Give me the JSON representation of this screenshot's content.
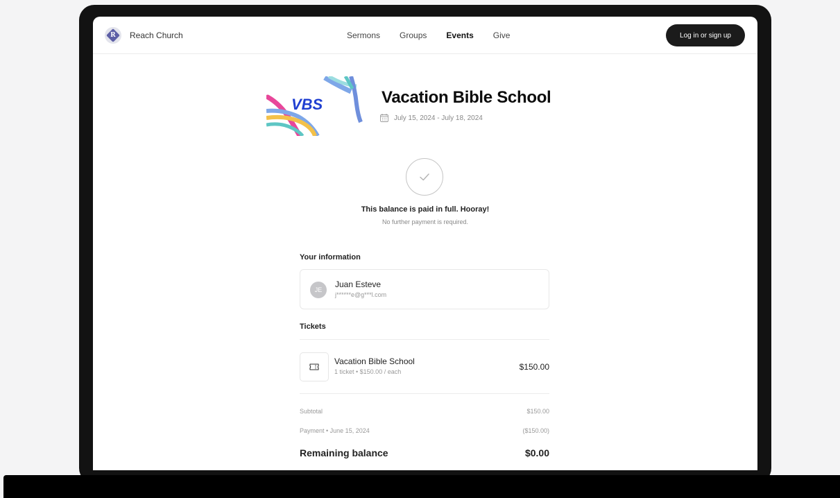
{
  "nav": {
    "brand": "Reach Church",
    "brand_initial": "R",
    "links": [
      "Sermons",
      "Groups",
      "Events",
      "Give"
    ],
    "active_link": "Events",
    "login_label": "Log in or sign up"
  },
  "event": {
    "image_text": "VBS",
    "title": "Vacation Bible School",
    "date_range": "July 15, 2024 - July 18, 2024"
  },
  "status": {
    "title": "This balance is paid in full. Hooray!",
    "subtitle": "No further payment is required."
  },
  "your_info": {
    "heading": "Your information",
    "initials": "JE",
    "name": "Juan Esteve",
    "email": "j******e@g***l.com"
  },
  "tickets": {
    "heading": "Tickets",
    "items": [
      {
        "name": "Vacation Bible School",
        "detail": "1 ticket • $150.00 / each",
        "price": "$150.00"
      }
    ]
  },
  "summary": {
    "subtotal_label": "Subtotal",
    "subtotal_value": "$150.00",
    "payment_label": "Payment • June 15, 2024",
    "payment_value": "($150.00)",
    "remaining_label": "Remaining balance",
    "remaining_value": "$0.00"
  },
  "colors": {
    "brand_accent": "#5d5fa6",
    "button_bg": "#1b1b1b"
  }
}
